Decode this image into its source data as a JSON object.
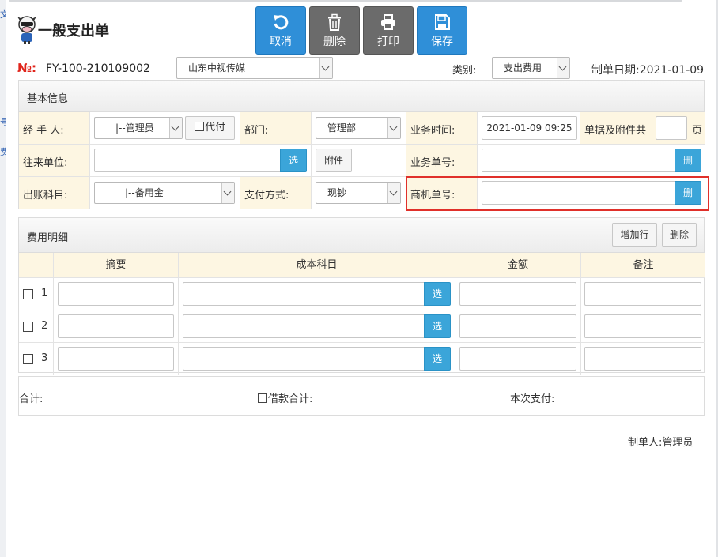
{
  "edge_fragments": [
    "文",
    "号",
    "费"
  ],
  "header": {
    "title": "一般支出单",
    "logo": "cartoon-cow-logo-icon"
  },
  "toolbar": [
    {
      "label": "取消",
      "icon": "undo-icon",
      "color": "#2f8fd8"
    },
    {
      "label": "删除",
      "icon": "trash-icon",
      "color": "#6b6b6b"
    },
    {
      "label": "打印",
      "icon": "printer-icon",
      "color": "#6b6b6b"
    },
    {
      "label": "保存",
      "icon": "save-icon",
      "color": "#2f8fd8"
    }
  ],
  "doc": {
    "no_label": "№:",
    "no_value": "FY-100-210109002",
    "company": "山东中视传媒",
    "category_label": "类别:",
    "category": "支出费用",
    "date_label": "制单日期:",
    "date": "2021-01-09"
  },
  "basic": {
    "title": "基本信息",
    "handler_label": "经 手 人:",
    "handler": "|--管理员",
    "proxy_label": "代付",
    "dept_label": "部门:",
    "dept": "管理部",
    "biz_time_label": "业务时间:",
    "biz_time": "2021-01-09 09:25",
    "attach_count_label": "单据及附件共",
    "attach_count": "",
    "attach_unit": "页",
    "partner_label": "往来单位:",
    "partner": "",
    "select_label": "选",
    "attachment_label": "附件",
    "biz_no_label": "业务单号:",
    "biz_no": "",
    "delete_label": "删",
    "account_label": "出账科目:",
    "account": "|--备用金",
    "pay_method_label": "支付方式:",
    "pay_method": "现钞",
    "opp_no_label": "商机单号:",
    "opp_no": ""
  },
  "detail": {
    "title": "费用明细",
    "add_row_label": "增加行",
    "delete_label": "删除",
    "columns": [
      "摘要",
      "成本科目",
      "金额",
      "备注"
    ],
    "rows": [
      {
        "no": "1",
        "summary": "",
        "cost_item": "",
        "amount": "",
        "remark": ""
      },
      {
        "no": "2",
        "summary": "",
        "cost_item": "",
        "amount": "",
        "remark": ""
      },
      {
        "no": "3",
        "summary": "",
        "cost_item": "",
        "amount": "",
        "remark": ""
      }
    ],
    "select_label": "选"
  },
  "totals": {
    "sum_label": "合计:",
    "loan_sum_label": "借款合计:",
    "this_payment_label": "本次支付:"
  },
  "footer": {
    "creator_label": "制单人:",
    "creator": "管理员"
  },
  "colors": {
    "primary": "#2f8fd8",
    "gray_button": "#6b6b6b",
    "addon": "#3ba5d9",
    "label_bg": "#fdf6e2",
    "highlight": "#e0302a",
    "no_label": "#e0241b"
  }
}
